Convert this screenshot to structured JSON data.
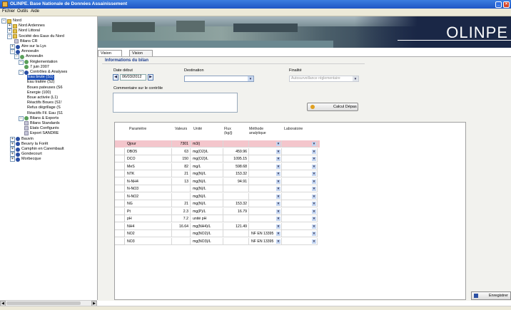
{
  "window": {
    "title": "OLINPE. Base Nationale de Données Assainissement"
  },
  "menu": [
    "Fichier",
    "Outils",
    "Aide"
  ],
  "tree": [
    {
      "label": "Nord",
      "exp": "−",
      "icon": "folder"
    },
    {
      "label": "Nord Ardennes",
      "exp": "+",
      "icon": "folder"
    },
    {
      "label": "Nord Littoral",
      "exp": "+",
      "icon": "folder"
    },
    {
      "label": "Société des Eaux du Nord",
      "exp": "−",
      "icon": "folder"
    },
    {
      "label": "Bilans CR",
      "exp": "",
      "icon": "doc"
    },
    {
      "label": "Aire sur la Lys",
      "exp": "+",
      "icon": "globe"
    },
    {
      "label": "Annoeulin",
      "exp": "−",
      "icon": "globe"
    },
    {
      "label": "Annoeulin",
      "exp": "−",
      "icon": "leaf"
    },
    {
      "label": "Réglementation",
      "exp": "−",
      "icon": "leaf"
    },
    {
      "label": "7 juin 2007",
      "exp": "",
      "icon": "leaf"
    },
    {
      "label": "Contrôles & Analyses",
      "exp": "−",
      "icon": "globe"
    },
    {
      "label": "Eau brute (S1)",
      "exp": "",
      "icon": "",
      "selected": true
    },
    {
      "label": "Eau traitée (S2)",
      "exp": "",
      "icon": ""
    },
    {
      "label": "Boues pateuses (S6",
      "exp": "",
      "icon": ""
    },
    {
      "label": "Energie (100)",
      "exp": "",
      "icon": ""
    },
    {
      "label": "Boue activée (L1)",
      "exp": "",
      "icon": ""
    },
    {
      "label": "Réactifs Boues (S1!",
      "exp": "",
      "icon": ""
    },
    {
      "label": "Refus dégrillage (S",
      "exp": "",
      "icon": ""
    },
    {
      "label": "Réactifs Fil. Eau (S1",
      "exp": "",
      "icon": ""
    },
    {
      "label": "Bilans & Exports",
      "exp": "−",
      "icon": "leaf"
    },
    {
      "label": "Bilans Standards",
      "exp": "",
      "icon": "doc"
    },
    {
      "label": "Etats Configurés",
      "exp": "",
      "icon": "doc"
    },
    {
      "label": "Export SANDRE",
      "exp": "",
      "icon": "doc"
    },
    {
      "label": "Bauvin",
      "exp": "+",
      "icon": "globe"
    },
    {
      "label": "Beuvry la Forêt",
      "exp": "+",
      "icon": "globe"
    },
    {
      "label": "Camphin en Carembault",
      "exp": "+",
      "icon": "globe"
    },
    {
      "label": "Gondecourt",
      "exp": "+",
      "icon": "globe"
    },
    {
      "label": "Morbecque",
      "exp": "+",
      "icon": "globe"
    }
  ],
  "banner": {
    "brand": "OLINPE"
  },
  "tabs": [
    "Vision journalière",
    "Vision mensuelle"
  ],
  "info": {
    "section_title": "Informations du bilan",
    "date_label": "Date début",
    "date_value": "06/03/2012",
    "destination_label": "Destination",
    "destination_value": "",
    "finalite_label": "Finalité",
    "finalite_value": "Autosurveillance réglementaire",
    "comment_label": "Commentaire sur le contrôle",
    "comment_value": "",
    "calc_button": "Calcul Dépas"
  },
  "grid": {
    "headers": [
      "Paramètre",
      "Valeurs",
      "Unité",
      "Flux\n(kg/j)",
      "Méthode\nanalytique",
      "Laboratoire"
    ],
    "rows": [
      {
        "param": "Qjour",
        "value": "7301",
        "unit": "m3/j",
        "flux": "",
        "method": "",
        "lab": ""
      },
      {
        "param": "DBO5",
        "value": "63",
        "unit": "mg(O2)/L",
        "flux": "459.96",
        "method": "",
        "lab": ""
      },
      {
        "param": "DCO",
        "value": "150",
        "unit": "mg(O2)/L",
        "flux": "1095.15",
        "method": "",
        "lab": ""
      },
      {
        "param": "MeS",
        "value": "82",
        "unit": "mg/L",
        "flux": "598.68",
        "method": "",
        "lab": ""
      },
      {
        "param": "NTK",
        "value": "21",
        "unit": "mg(N)/L",
        "flux": "153.32",
        "method": "",
        "lab": ""
      },
      {
        "param": "N-NH4",
        "value": "13",
        "unit": "mg(N)/L",
        "flux": "94.91",
        "method": "",
        "lab": ""
      },
      {
        "param": "N-NO3",
        "value": "",
        "unit": "mg(N)/L",
        "flux": "",
        "method": "",
        "lab": ""
      },
      {
        "param": "N-NO2",
        "value": "",
        "unit": "mg(N)/L",
        "flux": "",
        "method": "",
        "lab": ""
      },
      {
        "param": "NG",
        "value": "21",
        "unit": "mg(N)/L",
        "flux": "153.32",
        "method": "",
        "lab": ""
      },
      {
        "param": "Pt",
        "value": "2.3",
        "unit": "mg(P)/L",
        "flux": "16.79",
        "method": "",
        "lab": ""
      },
      {
        "param": "pH",
        "value": "7.2",
        "unit": "unité pH",
        "flux": "",
        "method": "",
        "lab": ""
      },
      {
        "param": "NH4",
        "value": "16.64",
        "unit": "mg(NH4)/L",
        "flux": "121.49",
        "method": "",
        "lab": ""
      },
      {
        "param": "NO2",
        "value": "",
        "unit": "mg(NO2)/L",
        "flux": "",
        "method": "NF EN 13395",
        "lab": ""
      },
      {
        "param": "NO3",
        "value": "",
        "unit": "mg(NO3)/L",
        "flux": "",
        "method": "NF EN 13395",
        "lab": ""
      }
    ]
  },
  "save_button": "Enregistrer"
}
